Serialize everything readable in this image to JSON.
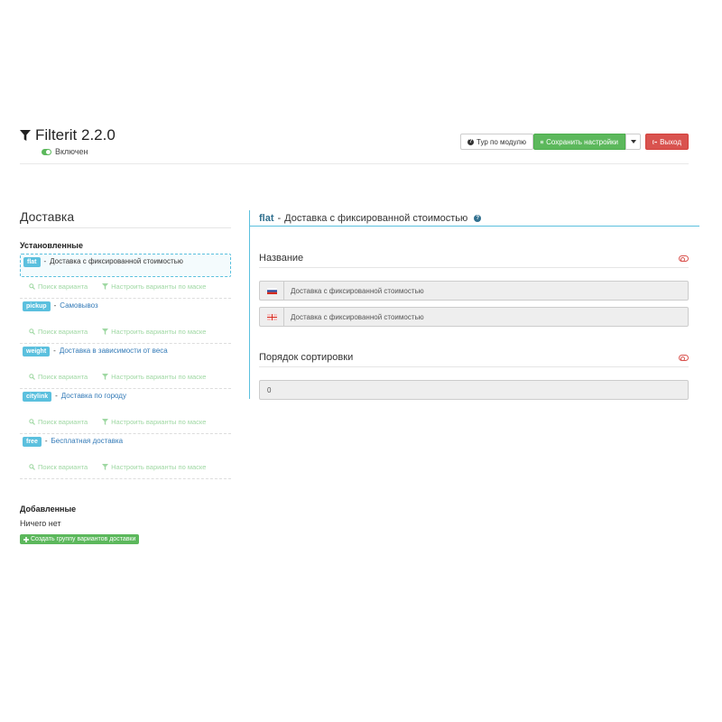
{
  "header": {
    "title": "Filterit 2.2.0",
    "status_label": "Включен",
    "tour_button": "Тур по модулю",
    "save_button": "Сохранить настройки",
    "exit_button": "Выход"
  },
  "sidebar": {
    "section_title": "Доставка",
    "installed_title": "Установленные",
    "items": [
      {
        "code": "flat",
        "label": "Доставка с фиксированной стоимостью",
        "active": true
      },
      {
        "code": "pickup",
        "label": "Самовывоз",
        "active": false
      },
      {
        "code": "weight",
        "label": "Доставка в зависимости от веса",
        "active": false
      },
      {
        "code": "citylink",
        "label": "Доставка по городу",
        "active": false
      },
      {
        "code": "free",
        "label": "Бесплатная доставка",
        "active": false
      }
    ],
    "search_action": "Поиск варианта",
    "mask_action": "Настроить варианты по маске",
    "added_title": "Добавленные",
    "empty_text": "Ничего нет",
    "create_button": "Создать группу вариантов доставки"
  },
  "detail": {
    "code": "flat",
    "separator": "-",
    "title": "Доставка с фиксированной стоимостью",
    "name_section": "Название",
    "name_values": [
      {
        "lang": "ru",
        "value": "Доставка с фиксированной стоимостью"
      },
      {
        "lang": "en",
        "value": "Доставка с фиксированной стоимостью"
      }
    ],
    "sort_section": "Порядок сортировки",
    "sort_value": "0"
  },
  "colors": {
    "info": "#5bc0de",
    "success": "#5cb85c",
    "danger": "#d9534f",
    "link": "#337ab7"
  }
}
